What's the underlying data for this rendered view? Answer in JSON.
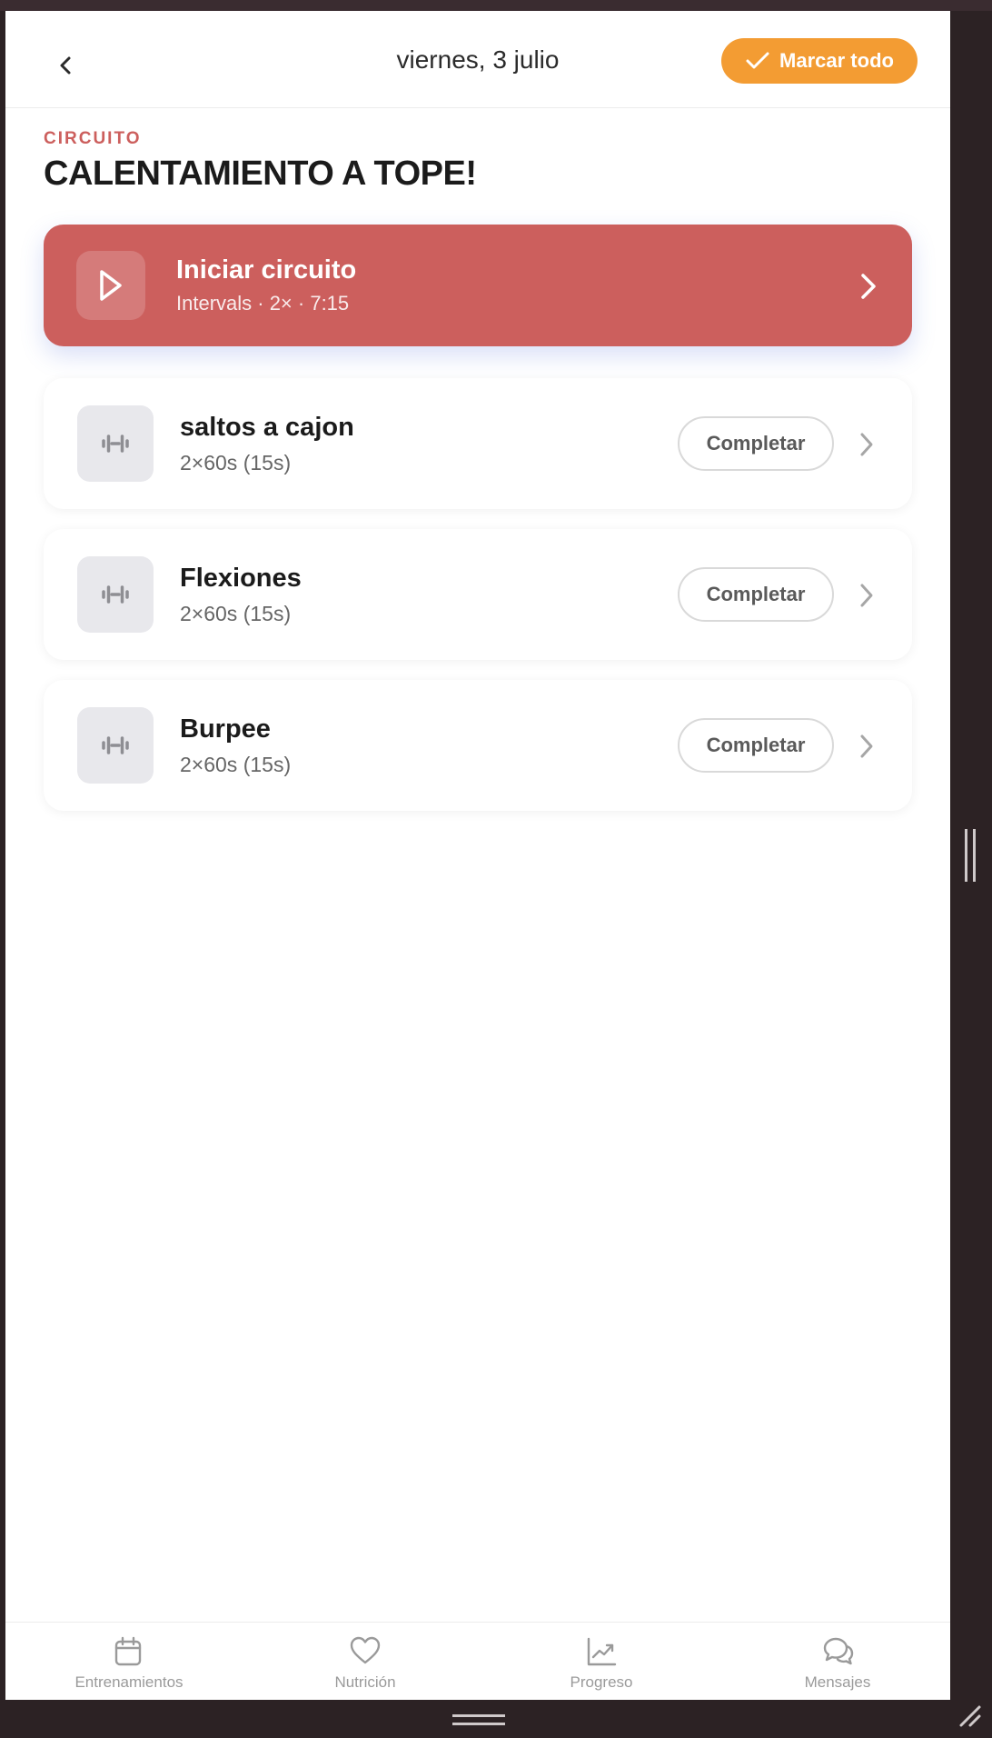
{
  "colors": {
    "accent_red": "#cc5f5d",
    "accent_orange": "#f39c33",
    "icon_gray": "#8e8e93"
  },
  "header": {
    "back_icon": "chevron-left-icon",
    "date": "viernes, 3 julio",
    "mark_all_icon": "checkmark-icon",
    "mark_all_label": "Marcar todo"
  },
  "workout": {
    "type_label": "CIRCUITO",
    "title": "CALENTAMIENTO A TOPE!"
  },
  "start": {
    "icon": "play-icon",
    "title": "Iniciar circuito",
    "subtitle": "Intervals · 2× · 7:15",
    "chevron": "chevron-right-icon"
  },
  "exercises": [
    {
      "icon": "dumbbell-icon",
      "name": "saltos a cajon",
      "detail": "2×60s (15s)",
      "action": "Completar"
    },
    {
      "icon": "dumbbell-icon",
      "name": "Flexiones",
      "detail": "2×60s (15s)",
      "action": "Completar"
    },
    {
      "icon": "dumbbell-icon",
      "name": "Burpee",
      "detail": "2×60s (15s)",
      "action": "Completar"
    }
  ],
  "tabs": [
    {
      "icon": "calendar-icon",
      "label": "Entrenamientos"
    },
    {
      "icon": "heart-icon",
      "label": "Nutrición"
    },
    {
      "icon": "chart-trend-icon",
      "label": "Progreso"
    },
    {
      "icon": "chat-bubbles-icon",
      "label": "Mensajes"
    }
  ]
}
